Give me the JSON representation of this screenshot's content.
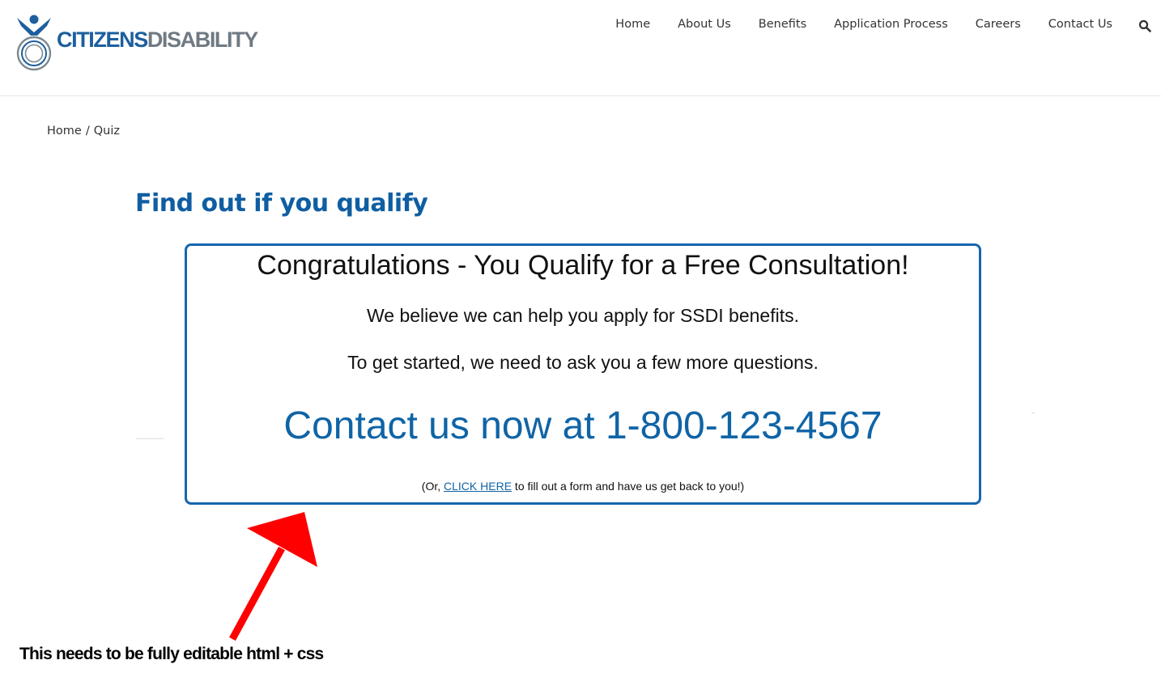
{
  "brand": {
    "name_part1": "CITIZENS",
    "name_part2": "DISABILITY",
    "primary_color": "#1d5f9d",
    "secondary_color": "#6f7a83"
  },
  "nav": {
    "items": [
      {
        "label": "Home"
      },
      {
        "label": "About Us"
      },
      {
        "label": "Benefits"
      },
      {
        "label": "Application Process"
      },
      {
        "label": "Careers"
      },
      {
        "label": "Contact Us"
      }
    ],
    "search_icon": "search-icon"
  },
  "breadcrumb": {
    "home": "Home",
    "separator": "/",
    "current": "Quiz"
  },
  "page": {
    "title": "Find out if you qualify"
  },
  "result": {
    "heading": "Congratulations - You Qualify for a Free Consultation!",
    "line1": "We believe we can help you apply for SSDI benefits.",
    "line2": "To get started, we need to ask you a few more questions.",
    "phone_text": "Contact us now at 1-800-123-4567",
    "note_prefix": "(Or, ",
    "note_link": "CLICK HERE",
    "note_suffix": " to fill out a form and have us get back to you!)",
    "border_color": "#1566ad",
    "accent_color": "#0f64a6"
  },
  "annotation": {
    "text": "This needs to be fully editable html + css",
    "arrow_color": "#ff0000"
  }
}
